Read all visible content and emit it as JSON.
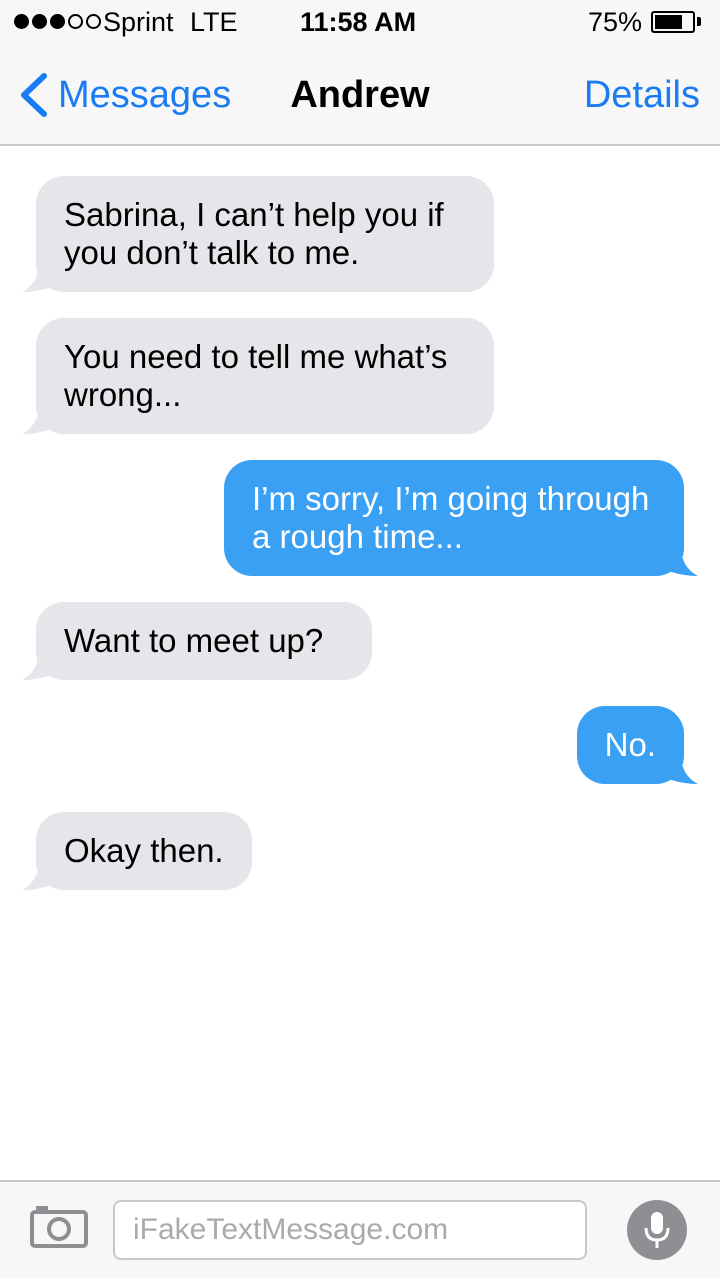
{
  "status_bar": {
    "carrier": "Sprint",
    "network": "LTE",
    "time": "11:58 AM",
    "battery_percent": "75%",
    "battery_level": 0.75,
    "signal_strength": 3,
    "signal_max": 5
  },
  "nav": {
    "back_label": "Messages",
    "title": "Andrew",
    "details_label": "Details"
  },
  "messages": [
    {
      "direction": "received",
      "text": "Sabrina, I can’t help you if you don’t talk to me."
    },
    {
      "direction": "received",
      "text": "You need to tell me what’s wrong..."
    },
    {
      "direction": "sent",
      "text": "I’m sorry, I’m going through a rough time..."
    },
    {
      "direction": "received",
      "text": "Want to meet up?"
    },
    {
      "direction": "sent",
      "text": "No."
    },
    {
      "direction": "received",
      "text": "Okay then."
    }
  ],
  "input": {
    "placeholder": "iFakeTextMessage.com",
    "value": ""
  },
  "colors": {
    "accent": "#1a7cf5",
    "sent_bubble": "#3aa0f3",
    "received_bubble": "#e5e5ea",
    "bar_background": "#f7f7f7",
    "mic_button": "#8e8e93"
  },
  "icons": {
    "back": "chevron-left-icon",
    "camera": "camera-icon",
    "mic": "microphone-icon"
  }
}
